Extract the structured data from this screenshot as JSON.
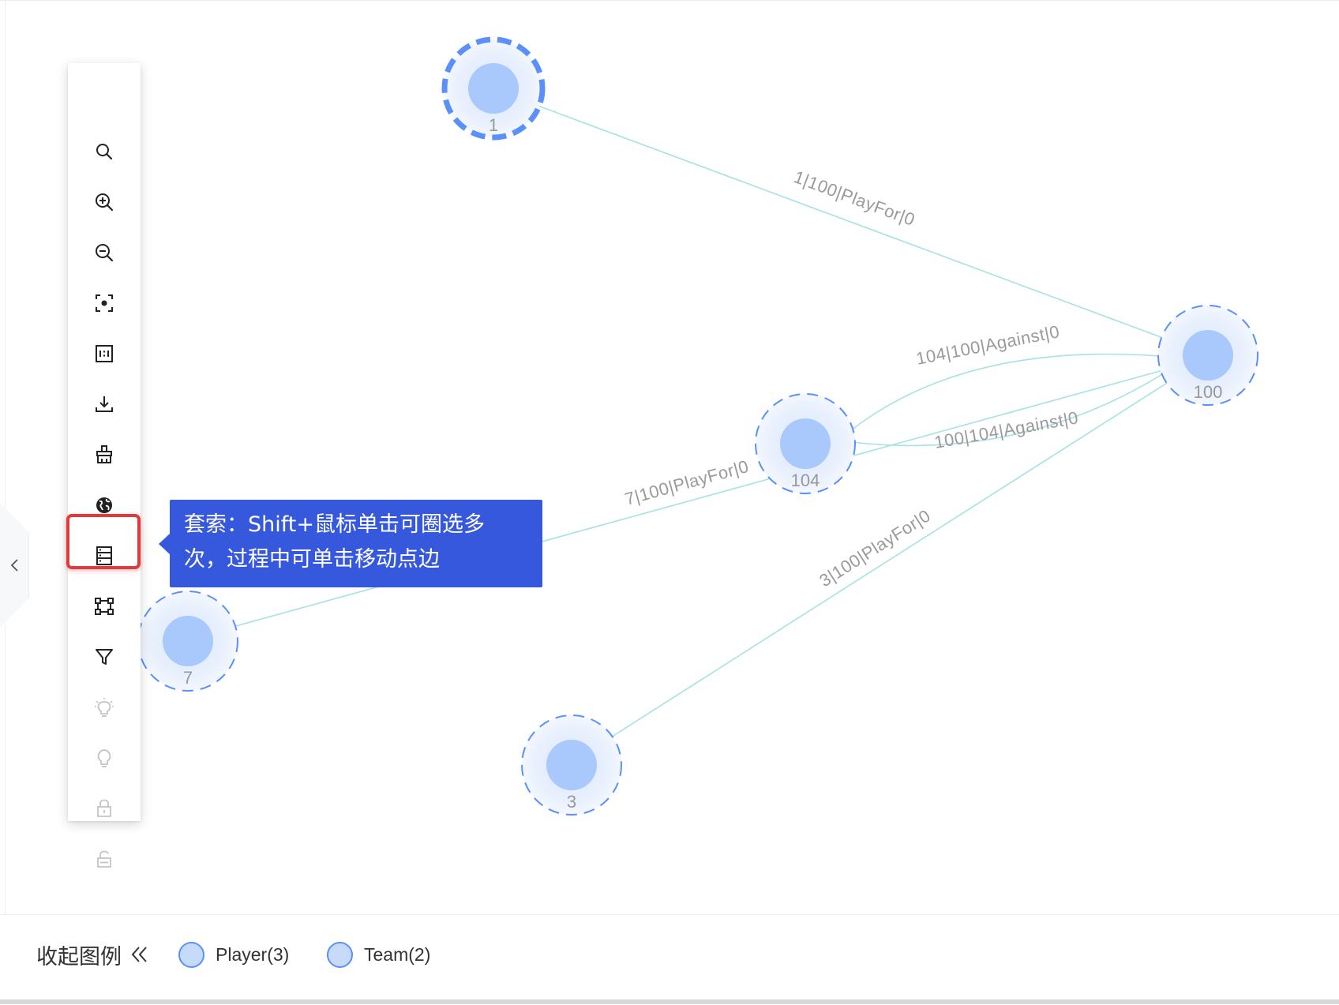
{
  "graph": {
    "nodes": [
      {
        "id": "1",
        "label": "1",
        "selected": true
      },
      {
        "id": "100",
        "label": "100",
        "selected": false
      },
      {
        "id": "104",
        "label": "104",
        "selected": false
      },
      {
        "id": "7",
        "label": "7",
        "selected": false
      },
      {
        "id": "3",
        "label": "3",
        "selected": false
      }
    ],
    "edges": [
      {
        "source": "1",
        "target": "100",
        "label": "1|100|PlayFor|0"
      },
      {
        "source": "104",
        "target": "100",
        "label": "104|100|Against|0"
      },
      {
        "source": "100",
        "target": "104",
        "label": "100|104|Against|0"
      },
      {
        "source": "7",
        "target": "100",
        "label": "7|100|PlayFor|0"
      },
      {
        "source": "3",
        "target": "100",
        "label": "3|100|PlayFor|0"
      }
    ],
    "colors": {
      "node_fill": "#a9c8fb",
      "node_halo": "#e6effd",
      "node_ring": "#5b8ff9",
      "edge": "#a5e3e0",
      "edge_label": "#9a9a9a"
    }
  },
  "toolbar": {
    "items": [
      {
        "icon": "search-icon",
        "enabled": true
      },
      {
        "icon": "zoom-in-icon",
        "enabled": true
      },
      {
        "icon": "zoom-out-icon",
        "enabled": true
      },
      {
        "icon": "focus-center-icon",
        "enabled": true
      },
      {
        "icon": "actual-size-icon",
        "enabled": true
      },
      {
        "icon": "download-icon",
        "enabled": true
      },
      {
        "icon": "clear-canvas-icon",
        "enabled": true
      },
      {
        "icon": "globe-icon",
        "enabled": true
      },
      {
        "icon": "table-view-icon",
        "enabled": true
      },
      {
        "icon": "lasso-select-icon",
        "enabled": true,
        "highlighted": true
      },
      {
        "icon": "filter-icon",
        "enabled": true
      },
      {
        "icon": "bulb-on-icon",
        "enabled": false
      },
      {
        "icon": "bulb-off-icon",
        "enabled": false
      },
      {
        "icon": "lock-icon",
        "enabled": false
      },
      {
        "icon": "unlock-icon",
        "enabled": false
      }
    ]
  },
  "tooltip": {
    "line1": "套索：Shift+鼠标单击可圈选多",
    "line2": "次，过程中可单击移动点边",
    "background": "#3558dd"
  },
  "legend": {
    "collapse_label": "收起图例",
    "items": [
      {
        "label": "Player(3)",
        "color": "#c6daf9"
      },
      {
        "label": "Team(2)",
        "color": "#c6daf9"
      }
    ]
  },
  "highlight_color": "#e03a3a"
}
